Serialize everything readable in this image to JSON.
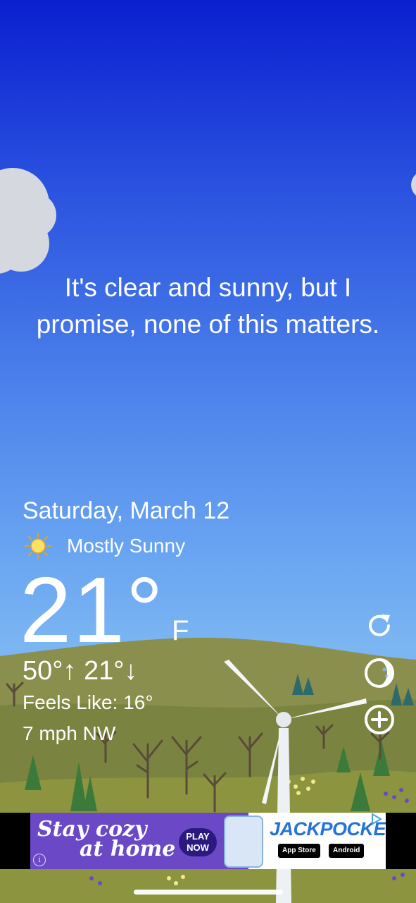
{
  "message": "It's clear and sunny, but I promise, none of this matters.",
  "weather": {
    "date": "Saturday, March 12",
    "condition": "Mostly Sunny",
    "condition_icon": "sun-icon",
    "temperature": "21°",
    "unit": "F",
    "high_low": "50°↑  21°↓",
    "feels_like": "Feels Like: 16°",
    "wind": "7 mph NW"
  },
  "controls": {
    "refresh_icon": "refresh-icon",
    "theme_icon": "theme-toggle-icon",
    "add_icon": "add-location-icon"
  },
  "ad": {
    "headline_line1": "Stay cozy",
    "headline_line2": "at home",
    "cta": "PLAY NOW",
    "brand": "JACKPOCKET",
    "store_apple": "App Store",
    "store_android": "Android",
    "info_icon": "info-icon"
  },
  "colors": {
    "sky_top": "#0a1fd0",
    "sky_bottom": "#7cb6f2",
    "hill": "#8a8f4e",
    "ad_purple": "#6a48c6",
    "ad_brand_blue": "#2573d9"
  }
}
